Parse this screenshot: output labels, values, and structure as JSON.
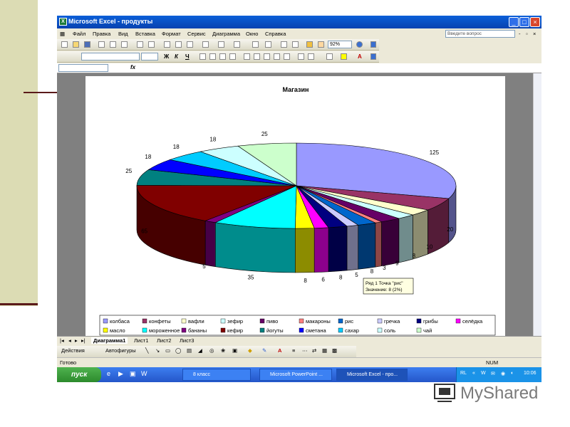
{
  "window": {
    "title": "Microsoft Excel - продукты",
    "app_icon": "excel-icon"
  },
  "menu": [
    "Файл",
    "Правка",
    "Вид",
    "Вставка",
    "Формат",
    "Сервис",
    "Диаграмма",
    "Окно",
    "Справка"
  ],
  "ask_placeholder": "Введите вопрос",
  "toolbar": {
    "zoom": "92%"
  },
  "formula": {
    "fx": "fx"
  },
  "chart_data": {
    "type": "pie",
    "title": "Магазин",
    "categories": [
      "колбаса",
      "конфеты",
      "вафли",
      "зефир",
      "пиво",
      "макароны",
      "рис",
      "гречка",
      "грибы",
      "селёдка",
      "масло",
      "мороженное",
      "бананы",
      "кефир",
      "йогуты",
      "сметана",
      "сахар",
      "соль",
      "чай"
    ],
    "values": [
      125,
      20,
      10,
      8,
      9,
      3,
      8,
      5,
      8,
      6,
      8,
      35,
      5,
      65,
      25,
      18,
      18,
      18,
      25
    ],
    "labels_shown": [
      "125",
      "20",
      "10",
      "8",
      "9",
      "3",
      "8",
      "5",
      "8",
      "6",
      "8",
      "35",
      "5",
      "65",
      "25",
      "18",
      "18",
      "18",
      "25"
    ],
    "colors": [
      "#9999ff",
      "#993366",
      "#ffffcc",
      "#ccffff",
      "#660066",
      "#ff8080",
      "#0066cc",
      "#ccccff",
      "#000080",
      "#ff00ff",
      "#ffff00",
      "#00ffff",
      "#800080",
      "#800000",
      "#008080",
      "#0000ff",
      "#00ccff",
      "#ccffff",
      "#ccffcc"
    ],
    "legend_position": "bottom",
    "tooltip": {
      "line1": "Ряд 1 Точка \"рис\"",
      "line2": "Значение: 8 (2%)"
    }
  },
  "sheets": [
    "Диаграмма1",
    "Лист1",
    "Лист2",
    "Лист3"
  ],
  "drawbar": {
    "actions": "Действия",
    "autoshapes": "Автофигуры"
  },
  "status": {
    "ready": "Готово",
    "num": "NUM"
  },
  "taskbar": {
    "start": "пуск",
    "tasks": [
      "8 класс",
      "Microsoft PowerPoint ...",
      "Microsoft Excel - про..."
    ],
    "lang": "RL",
    "clock": "10:06"
  },
  "brand": "MyShared"
}
